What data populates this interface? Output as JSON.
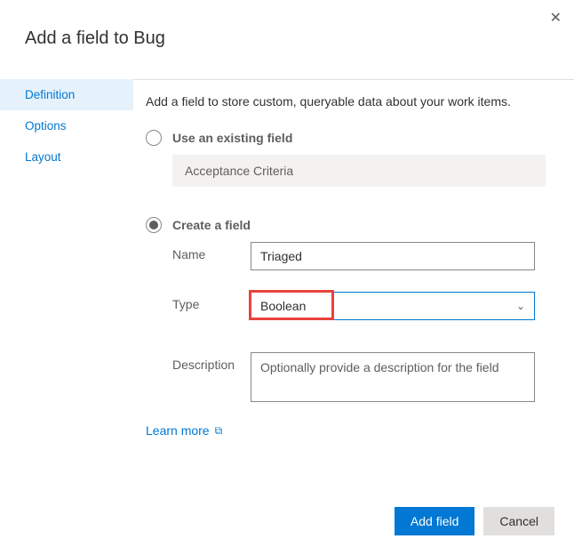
{
  "dialog": {
    "title": "Add a field to Bug",
    "intro": "Add a field to store custom, queryable data about your work items."
  },
  "sidebar": {
    "items": [
      {
        "label": "Definition",
        "active": true
      },
      {
        "label": "Options",
        "active": false
      },
      {
        "label": "Layout",
        "active": false
      }
    ]
  },
  "existing": {
    "radio_label": "Use an existing field",
    "value": "Acceptance Criteria",
    "selected": false
  },
  "create": {
    "radio_label": "Create a field",
    "selected": true,
    "name_label": "Name",
    "name_value": "Triaged",
    "type_label": "Type",
    "type_value": "Boolean",
    "description_label": "Description",
    "description_placeholder": "Optionally provide a description for the field"
  },
  "learn_more": {
    "label": "Learn more"
  },
  "footer": {
    "primary": "Add field",
    "secondary": "Cancel"
  }
}
